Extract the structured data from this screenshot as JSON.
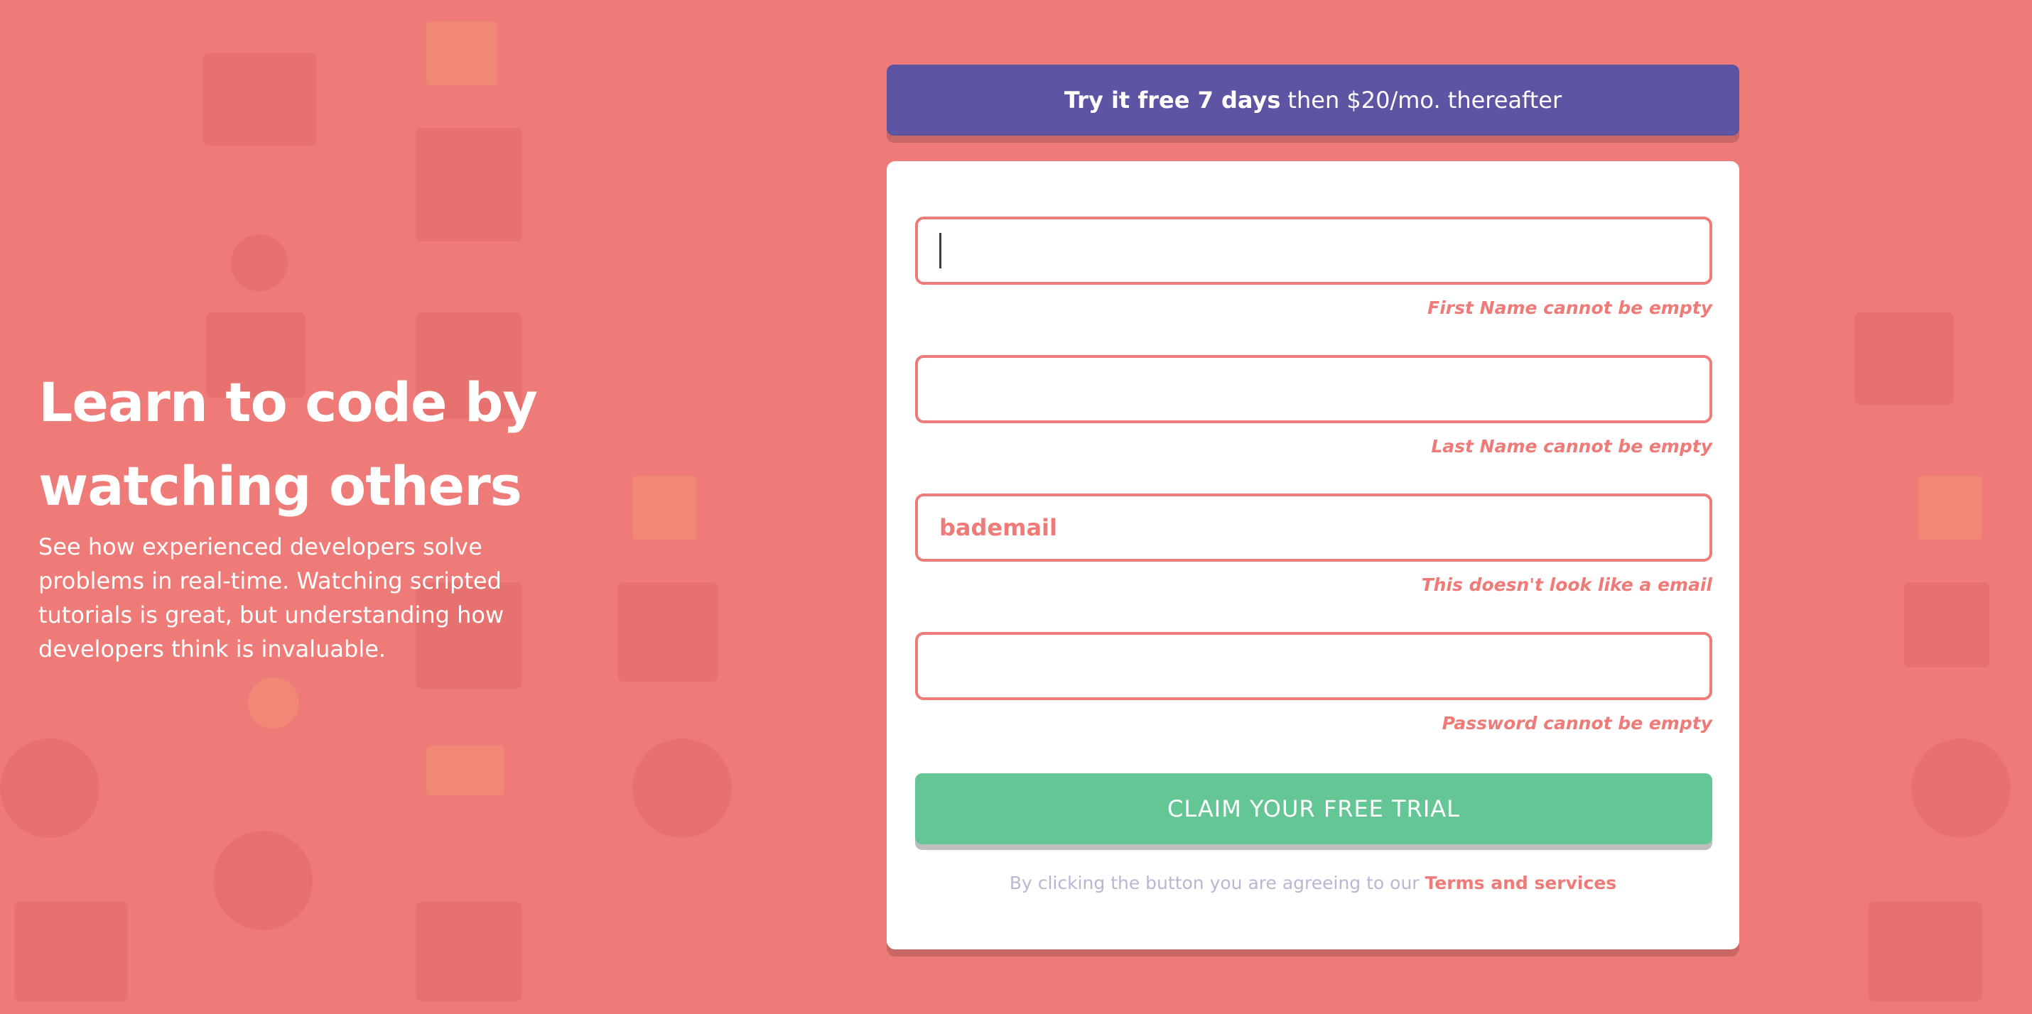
{
  "colors": {
    "background": "#ef7b78",
    "promo": "#5e54a4",
    "cta": "#65c695",
    "error": "#ef7b78",
    "muted": "#b9b6d3"
  },
  "hero": {
    "title_line1": "Learn to code by",
    "title_line2": "watching others",
    "description": "See how experienced developers solve problems in real-time. Watching scripted tutorials is great, but understanding how developers think is invaluable."
  },
  "promo": {
    "bold": "Try it free 7 days",
    "rest": "then $20/mo. thereafter"
  },
  "form": {
    "first_name": {
      "value": "",
      "error": "First Name cannot be empty"
    },
    "last_name": {
      "value": "",
      "error": "Last Name cannot be empty"
    },
    "email": {
      "value": "bademail",
      "error": "This doesn't look like a email"
    },
    "password": {
      "value": "",
      "error": "Password cannot be empty"
    },
    "submit_label": "CLAIM YOUR FREE TRIAL",
    "terms_prefix": "By clicking the button you are agreeing to our",
    "terms_link": "Terms and services"
  }
}
